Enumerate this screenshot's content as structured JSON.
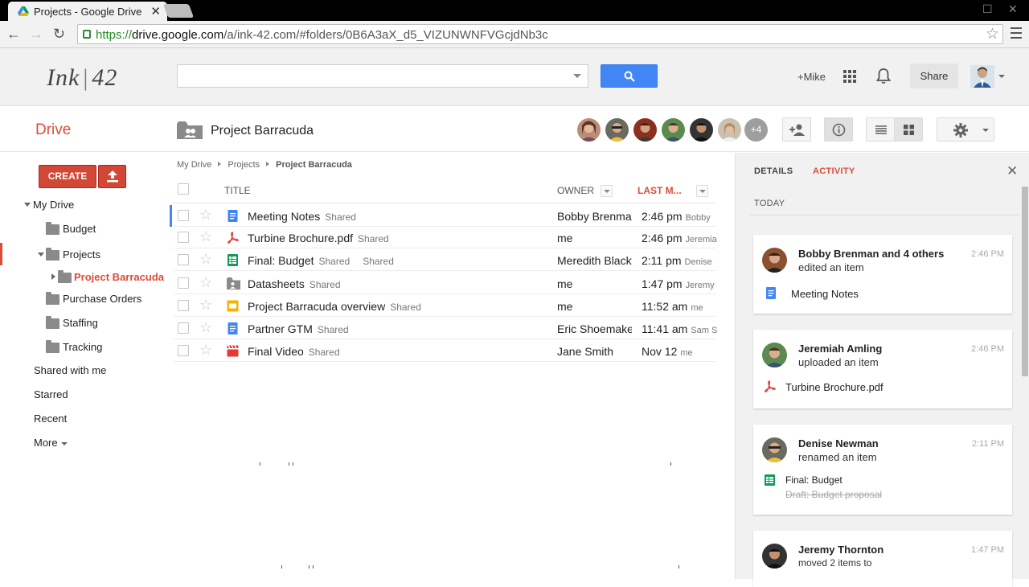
{
  "browser": {
    "tab_title": "Projects - Google Drive",
    "url_scheme": "https://",
    "url_host": "drive.google.com",
    "url_path": "/a/ink-42.com/#folders/0B6A3aX_d5_VIZUNWNFVGcjdNb3c"
  },
  "header": {
    "logo_left": "Ink",
    "logo_right": "42",
    "search_placeholder": "",
    "plus_user": "+Mike",
    "share_label": "Share"
  },
  "drive": {
    "app_title": "Drive",
    "folder_title": "Project Barracuda",
    "extra_collaborators": "+4"
  },
  "sidebar": {
    "create_label": "CREATE",
    "my_drive": "My Drive",
    "budget": "Budget",
    "projects": "Projects",
    "project_barracuda": "Project Barracuda",
    "purchase_orders": "Purchase Orders",
    "staffing": "Staffing",
    "tracking": "Tracking",
    "shared_with_me": "Shared with me",
    "starred": "Starred",
    "recent": "Recent",
    "more": "More"
  },
  "breadcrumb": {
    "items": [
      "My Drive",
      "Projects"
    ],
    "current": "Project Barracuda"
  },
  "list": {
    "columns": {
      "title": "TITLE",
      "owner": "OWNER",
      "modified": "LAST M..."
    },
    "rows": [
      {
        "name": "Meeting Notes",
        "shared": "Shared",
        "owner": "Bobby Brenman",
        "time": "2:46 pm",
        "by": "Bobby",
        "icon": "doc",
        "sharedtwice": ""
      },
      {
        "name": "Turbine Brochure.pdf",
        "shared": "Shared",
        "owner": "me",
        "time": "2:46 pm",
        "by": "Jeremiah",
        "icon": "pdf",
        "sharedtwice": ""
      },
      {
        "name": "Final: Budget",
        "shared": "Shared",
        "owner": "Meredith Blackwell",
        "time": "2:11 pm",
        "by": "Denise",
        "icon": "sheet",
        "sharedtwice": "Shared"
      },
      {
        "name": "Datasheets",
        "shared": "Shared",
        "owner": "me",
        "time": "1:47 pm",
        "by": "Jeremy",
        "icon": "folder",
        "sharedtwice": ""
      },
      {
        "name": "Project Barracuda overview",
        "shared": "Shared",
        "owner": "me",
        "time": "11:52 am",
        "by": "me",
        "icon": "slides",
        "sharedtwice": ""
      },
      {
        "name": "Partner GTM",
        "shared": "Shared",
        "owner": "Eric Shoemaker",
        "time": "11:41 am",
        "by": "Sam S",
        "icon": "doc",
        "sharedtwice": ""
      },
      {
        "name": "Final Video",
        "shared": "Shared",
        "owner": "Jane Smith",
        "time": "Nov 12",
        "by": "me",
        "icon": "video",
        "sharedtwice": ""
      }
    ]
  },
  "panel": {
    "tab_details": "DETAILS",
    "tab_activity": "ACTIVITY",
    "today_label": "TODAY",
    "cards": [
      {
        "name": "Bobby Brenman and 4 others",
        "action": "edited an item",
        "time": "2:46 PM",
        "item": "Meeting Notes",
        "old": ""
      },
      {
        "name": "Jeremiah Amling",
        "action": "uploaded an item",
        "time": "2:46 PM",
        "item": "Turbine Brochure.pdf",
        "old": ""
      },
      {
        "name": "Denise Newman",
        "action": "renamed an item",
        "time": "2:11 PM",
        "item": "Final: Budget",
        "old": "Draft: Budget proposal"
      },
      {
        "name": "Jeremy Thornton",
        "action": "moved 2 items to",
        "time": "1:47 PM",
        "item": "",
        "old": ""
      }
    ]
  },
  "colors": {
    "accent_red": "#dd4b39",
    "search_blue": "#4285f4",
    "doc_blue": "#4285f4",
    "sheet_green": "#0f9d58",
    "slides_yellow": "#f4b400",
    "pdf_red": "#e0483e"
  }
}
